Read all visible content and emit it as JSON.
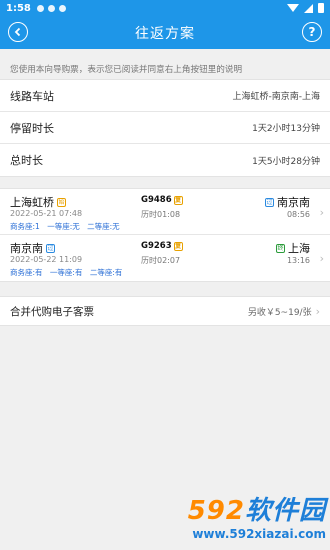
{
  "status_bar": {
    "time": "1:58"
  },
  "header": {
    "title": "往返方案",
    "back_icon": "back-icon",
    "help_label": "?"
  },
  "notice": "您使用本向导购票，表示您已阅读并同意右上角按钮里的说明",
  "summary": {
    "route_label": "线路车站",
    "route_value": "上海虹桥-南京南-上海",
    "stay_label": "停留时长",
    "stay_value": "1天2小时13分钟",
    "total_label": "总时长",
    "total_value": "1天5小时28分钟"
  },
  "trips": [
    {
      "from": "上海虹桥",
      "from_tag": "始",
      "date": "2022-05-21 07:48",
      "seats": [
        "商务座:1",
        "一等座:无",
        "二等座:无"
      ],
      "train": "G9486",
      "train_tag": "复",
      "duration": "历时01:08",
      "to": "南京南",
      "to_tag": "过",
      "arrive": "08:56"
    },
    {
      "from": "南京南",
      "from_tag": "过",
      "date": "2022-05-22 11:09",
      "seats": [
        "商务座:有",
        "一等座:有",
        "二等座:有"
      ],
      "train": "G9263",
      "train_tag": "复",
      "duration": "历时02:07",
      "to": "上海",
      "to_tag": "终",
      "arrive": "13:16"
    }
  ],
  "ticket": {
    "label": "合并代购电子客票",
    "value": "另收￥5~19/张"
  },
  "watermark": {
    "brand_num": "592",
    "brand_cn": "软件园",
    "url": "www.592xiazai.com"
  },
  "colors": {
    "primary": "#1e96e8",
    "seat_text": "#2b6fd6",
    "watermark_orange": "#ff8a00",
    "watermark_blue": "#1e7fd8"
  }
}
